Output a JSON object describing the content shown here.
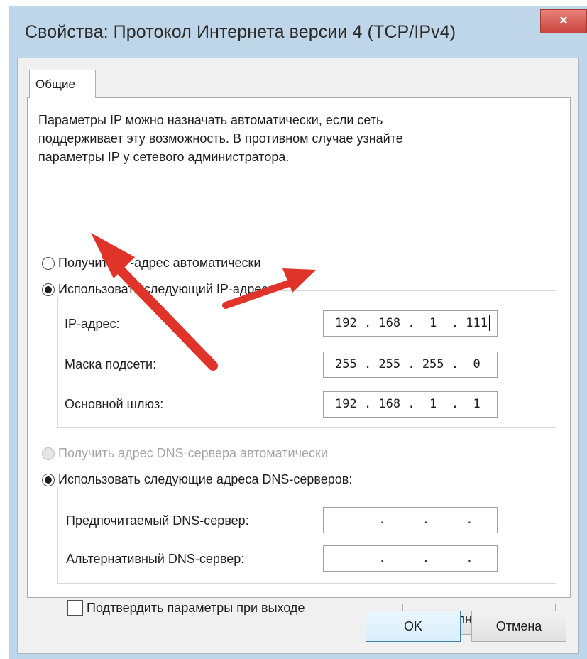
{
  "window": {
    "title": "Свойства: Протокол Интернета версии 4 (TCP/IPv4)",
    "close_label": "×"
  },
  "tabs": [
    {
      "label": "Общие",
      "selected": true
    }
  ],
  "description": "Параметры IP можно назначать автоматически, если сеть\nподдерживает эту возможность. В противном случае узнайте\nпараметры IP у сетевого администратора.",
  "ip_section": {
    "auto_label": "Получить IP-адрес автоматически",
    "manual_label": "Использовать следующий IP-адрес:",
    "selected": "manual",
    "fields": [
      {
        "label": "IP-адрес:",
        "value": "192 . 168 .  1  . 111"
      },
      {
        "label": "Маска подсети:",
        "value": "255 . 255 . 255 .  0"
      },
      {
        "label": "Основной шлюз:",
        "value": "192 . 168 .  1  .  1"
      }
    ]
  },
  "dns_section": {
    "auto_label": "Получить адрес DNS-сервера автоматически",
    "manual_label": "Использовать следующие адреса DNS-серверов:",
    "selected": "manual",
    "fields": [
      {
        "label": "Предпочитаемый DNS-сервер:",
        "value": "      .     .     ."
      },
      {
        "label": "Альтернативный DNS-сервер:",
        "value": "      .     .     ."
      }
    ]
  },
  "validate_label": "Подтвердить параметры при выходе",
  "buttons": {
    "advanced": "Дополнительно...",
    "ok": "OK",
    "cancel": "Отмена"
  },
  "colors": {
    "arrow": "#e0342a",
    "window_frame": "#bfd6e9",
    "close_button": "#c9453c"
  }
}
